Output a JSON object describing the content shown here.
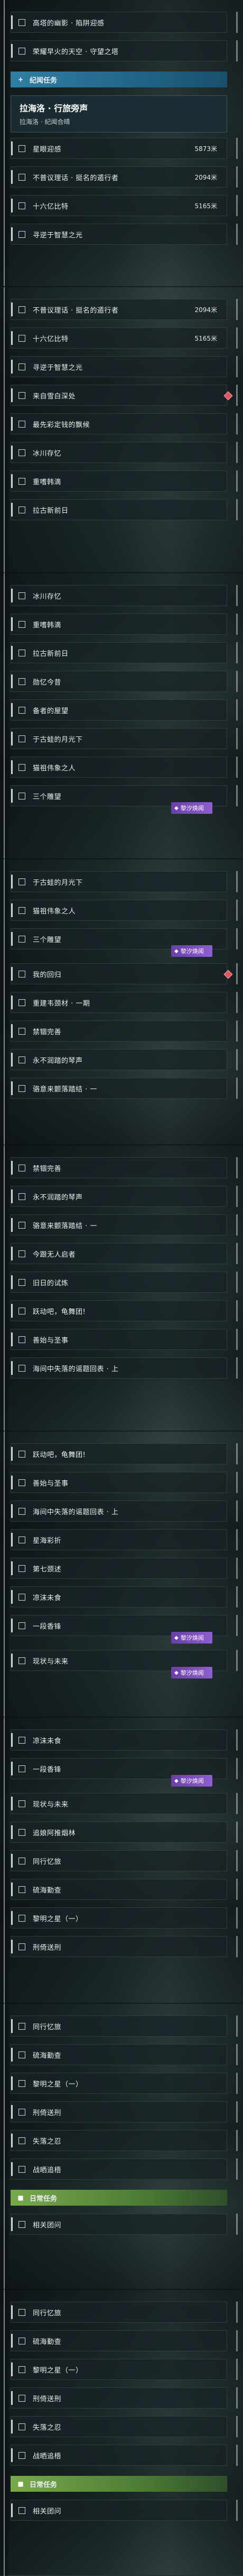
{
  "panels": [
    {
      "items": [
        {
          "type": "row",
          "label": "高塔的幽影 · 陷阱迎感"
        },
        {
          "type": "row",
          "label": "荣耀早火的天空 · 守望之塔"
        },
        {
          "type": "header",
          "variant": "blue",
          "icon": "+",
          "label": "纪闻任务"
        },
        {
          "type": "featured",
          "title": "拉海洛 · 行旅旁声",
          "subtitle": "拉海洛 · 纪闻合晴"
        },
        {
          "type": "row",
          "label": "星眼迎感",
          "dist": "5873米"
        },
        {
          "type": "row",
          "label": "不普议理话 · 挺名的遁行者",
          "dist": "2094米"
        },
        {
          "type": "row",
          "label": "十六亿比特",
          "dist": "5165米"
        },
        {
          "type": "row",
          "label": "寻逆于智慧之光"
        }
      ]
    },
    {
      "items": [
        {
          "type": "row",
          "label": "不普议理话 · 挺名的遁行者",
          "dist": "2094米"
        },
        {
          "type": "row",
          "label": "十六亿比特",
          "dist": "5165米"
        },
        {
          "type": "row",
          "label": "寻逆于智慧之光"
        },
        {
          "type": "row",
          "label": "来自雪白深处",
          "diamond": true
        },
        {
          "type": "row",
          "label": "最先彩定钱的飘候"
        },
        {
          "type": "row",
          "label": "冰川存忆"
        },
        {
          "type": "row",
          "label": "重嗜韩滴"
        },
        {
          "type": "row",
          "label": "拉古新前日"
        }
      ]
    },
    {
      "items": [
        {
          "type": "row",
          "label": "冰川存忆"
        },
        {
          "type": "row",
          "label": "重嗜韩滴"
        },
        {
          "type": "row",
          "label": "拉古新前日"
        },
        {
          "type": "row",
          "label": "勋忆今昔"
        },
        {
          "type": "row",
          "label": "备者的屋望"
        },
        {
          "type": "row",
          "label": "于古蛙的月光下"
        },
        {
          "type": "row",
          "label": "猫祖伟象之人"
        },
        {
          "type": "row",
          "label": "三个雕望",
          "badge": "黎汐焕闻"
        }
      ]
    },
    {
      "items": [
        {
          "type": "row",
          "label": "于古蛙的月光下"
        },
        {
          "type": "row",
          "label": "猫祖伟象之人"
        },
        {
          "type": "row",
          "label": "三个雕望",
          "badge": "黎汐焕闻"
        },
        {
          "type": "row",
          "label": "我的回归",
          "diamond": true
        },
        {
          "type": "row",
          "label": "重建韦颈材 · 一期"
        },
        {
          "type": "row",
          "label": "禁锢完善"
        },
        {
          "type": "row",
          "label": "永不润踏的琴声"
        },
        {
          "type": "row",
          "label": "骆意来颤落踏结 · 一"
        }
      ]
    },
    {
      "items": [
        {
          "type": "row",
          "label": "禁锢完善"
        },
        {
          "type": "row",
          "label": "永不润踏的琴声"
        },
        {
          "type": "row",
          "label": "骆意来颤落踏结 · 一"
        },
        {
          "type": "row",
          "label": "今跟无人启者"
        },
        {
          "type": "row",
          "label": "旧日的试炼"
        },
        {
          "type": "row",
          "label": "跃动吧，龟舞团!"
        },
        {
          "type": "row",
          "label": "善始与圣事"
        },
        {
          "type": "row",
          "label": "海间中失落的谣题回表 · 上"
        }
      ]
    },
    {
      "items": [
        {
          "type": "row",
          "label": "跃动吧，龟舞团!"
        },
        {
          "type": "row",
          "label": "善始与圣事"
        },
        {
          "type": "row",
          "label": "海间中失落的谣题回表 · 上"
        },
        {
          "type": "row",
          "label": "星海彩折"
        },
        {
          "type": "row",
          "label": "第七颈述"
        },
        {
          "type": "row",
          "label": "凉沫未食"
        },
        {
          "type": "row",
          "label": "一段香锋",
          "badge": "黎汐焕闻"
        },
        {
          "type": "row",
          "label": "现状与未来",
          "badge": "黎汐焕闻"
        }
      ]
    },
    {
      "items": [
        {
          "type": "row",
          "label": "凉沫未食"
        },
        {
          "type": "row",
          "label": "一段香锋",
          "badge": "黎汐焕闻"
        },
        {
          "type": "row",
          "label": "现状与未来"
        },
        {
          "type": "row",
          "label": "追娘阿推烟林"
        },
        {
          "type": "row",
          "label": "同行忆旅"
        },
        {
          "type": "row",
          "label": "硫海勤查"
        },
        {
          "type": "row",
          "label": "黎明之星（一）"
        },
        {
          "type": "row",
          "label": "刑倚送刑"
        }
      ]
    },
    {
      "items": [
        {
          "type": "row",
          "label": "同行忆旅"
        },
        {
          "type": "row",
          "label": "硫海勤查"
        },
        {
          "type": "row",
          "label": "黎明之星（一）"
        },
        {
          "type": "row",
          "label": "刑倚送刑"
        },
        {
          "type": "row",
          "label": "失落之忍"
        },
        {
          "type": "row",
          "label": "战晒追梧"
        },
        {
          "type": "header",
          "variant": "green",
          "icon": "■",
          "label": "日常任务"
        },
        {
          "type": "row",
          "label": "相关团问"
        }
      ]
    },
    {
      "items": [
        {
          "type": "row",
          "label": "同行忆旅"
        },
        {
          "type": "row",
          "label": "硫海勤查"
        },
        {
          "type": "row",
          "label": "黎明之星（一）"
        },
        {
          "type": "row",
          "label": "刑倚送刑"
        },
        {
          "type": "row",
          "label": "失落之忍"
        },
        {
          "type": "row",
          "label": "战晒追梧"
        },
        {
          "type": "header",
          "variant": "green",
          "icon": "■",
          "label": "日常任务"
        },
        {
          "type": "row",
          "label": "相关团问"
        }
      ]
    }
  ]
}
